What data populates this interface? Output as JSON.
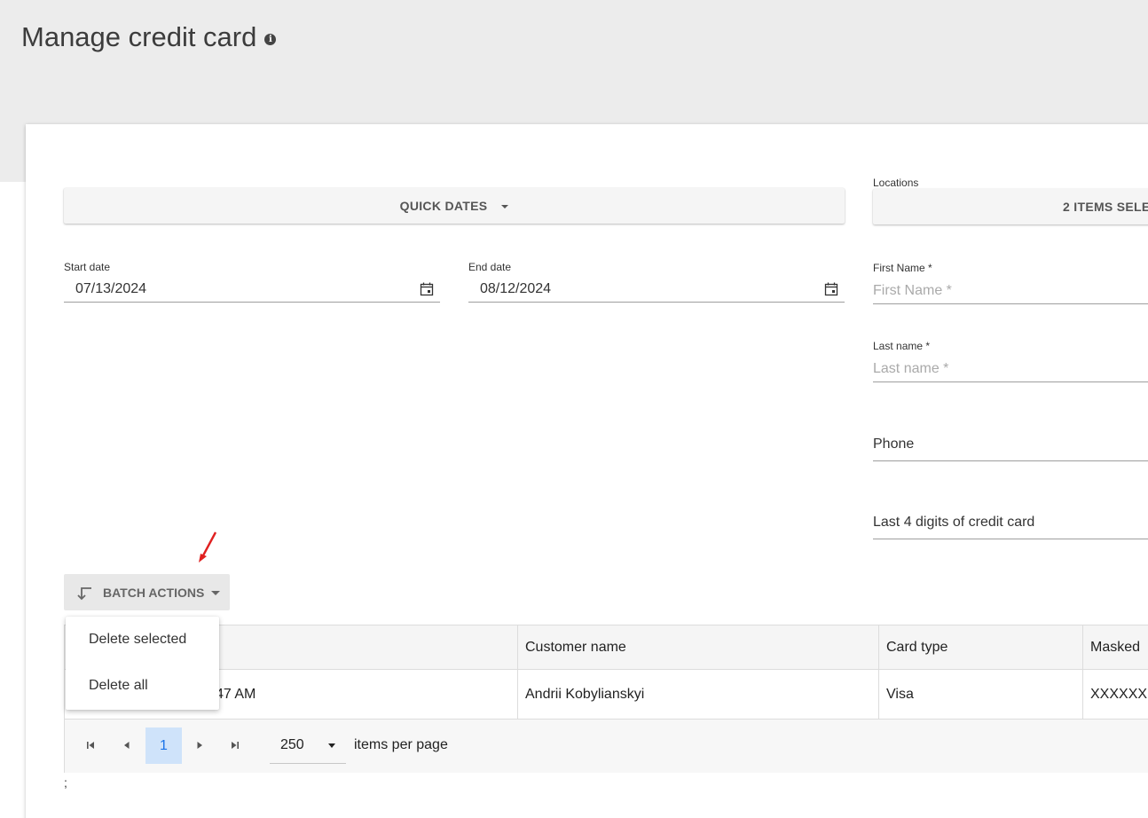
{
  "page": {
    "title": "Manage credit card",
    "info_icon": "info-icon"
  },
  "filters": {
    "quick_dates_label": "QUICK DATES",
    "locations_label": "Locations",
    "locations_value": "2 ITEMS SELE",
    "start_date_label": "Start date",
    "start_date_value": "07/13/2024",
    "end_date_label": "End date",
    "end_date_value": "08/12/2024",
    "first_name_label": "First Name *",
    "first_name_placeholder": "First Name *",
    "last_name_label": "Last name *",
    "last_name_placeholder": "Last name *",
    "phone_label": "Phone",
    "last4_label": "Last 4 digits of credit card"
  },
  "batch": {
    "button_label": "BATCH ACTIONS",
    "menu_items": [
      "Delete selected",
      "Delete all"
    ]
  },
  "grid": {
    "columns": [
      "",
      "Customer name",
      "Card type",
      "Masked"
    ],
    "rows": [
      {
        "date": "47 AM",
        "customer": "Andrii Kobylianskyi",
        "card_type": "Visa",
        "masked": "XXXXXX"
      }
    ]
  },
  "pager": {
    "current_page": "1",
    "page_size": "250",
    "items_per_page_label": "items per page"
  },
  "footer": {
    "stray_text": ";"
  },
  "colors": {
    "accent": "#1a73e8",
    "annotation_arrow": "#e02020"
  }
}
